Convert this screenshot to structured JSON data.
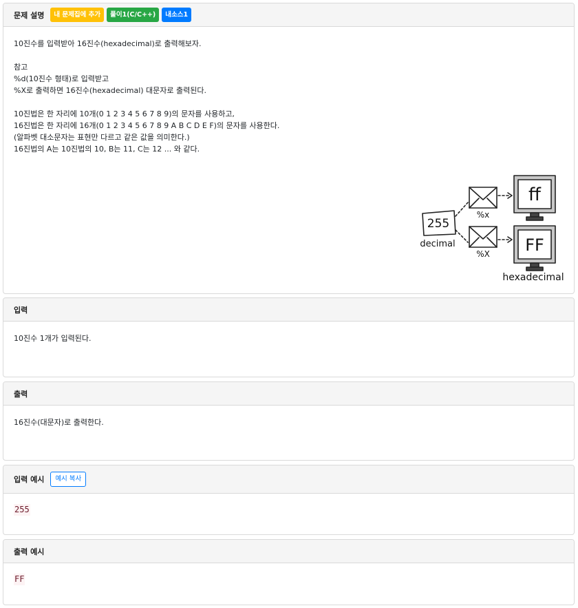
{
  "problem": {
    "title": "문제 설명",
    "buttons": {
      "add_to_list": "내 문제집에 추가",
      "solution": "풀이1(C/C++)",
      "my_source": "내소스1"
    },
    "lines": [
      "10진수를 입력받아 16진수(hexadecimal)로 출력해보자.",
      "",
      "참고",
      "%d(10진수 형태)로 입력받고",
      "%X로 출력하면 16진수(hexadecimal) 대문자로 출력된다.",
      "",
      "10진법은 한 자리에 10개(0 1 2 3 4 5 6 7 8 9)의 문자를 사용하고,",
      "16진법은 한 자리에 16개(0 1 2 3 4 5 6 7 8 9 A B C D E F)의 문자를 사용한다.",
      "(알파벳 대소문자는 표현만 다르고 같은 값을 의미한다.)",
      "16진법의 A는 10진법의 10, B는 11, C는 12 ... 와 같다."
    ],
    "illustration": {
      "decimal_value": "255",
      "decimal_label": "decimal",
      "lower_format": "%x",
      "upper_format": "%X",
      "lower_result": "ff",
      "upper_result": "FF",
      "hex_label": "hexadecimal"
    }
  },
  "input": {
    "title": "입력",
    "text": "10진수 1개가 입력된다."
  },
  "output": {
    "title": "출력",
    "text": "16진수(대문자)로 출력한다."
  },
  "sample_input": {
    "title": "입력 예시",
    "copy_button": "예시 복사",
    "value": "255"
  },
  "sample_output": {
    "title": "출력 예시",
    "value": "FF"
  }
}
